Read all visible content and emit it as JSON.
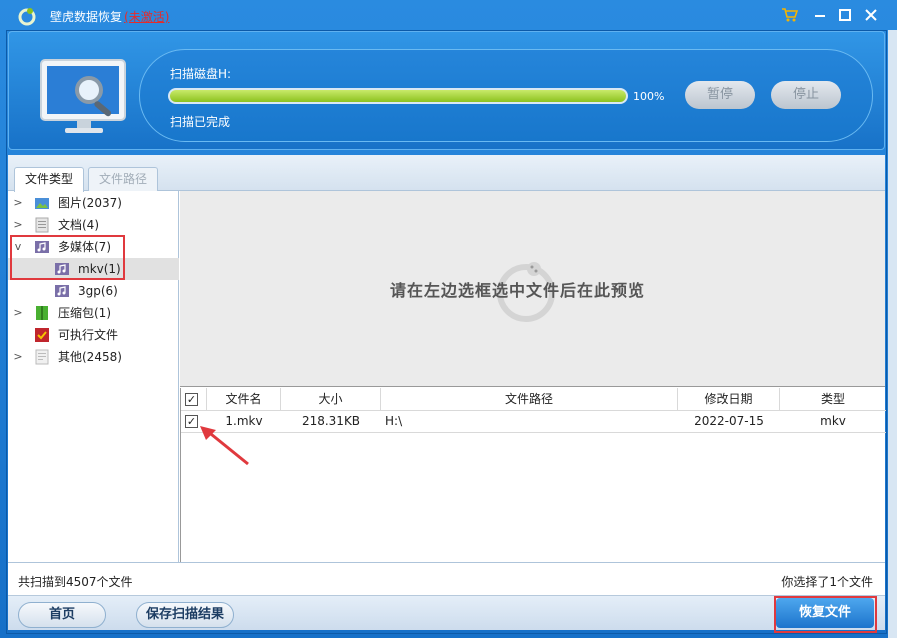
{
  "window": {
    "title": "壁虎数据恢复",
    "status": "(未激活)"
  },
  "scan": {
    "label": "扫描磁盘H:",
    "progress_percent": 100,
    "progress_text": "100%",
    "status": "扫描已完成",
    "pause_label": "暂停",
    "stop_label": "停止"
  },
  "tabs": [
    {
      "label": "文件类型"
    },
    {
      "label": "文件路径"
    }
  ],
  "tree": [
    {
      "label": "图片(2037)"
    },
    {
      "label": "文档(4)"
    },
    {
      "label": "多媒体(7)"
    },
    {
      "label": "mkv(1)"
    },
    {
      "label": "3gp(6)"
    },
    {
      "label": "压缩包(1)"
    },
    {
      "label": "可执行文件"
    },
    {
      "label": "其他(2458)"
    }
  ],
  "preview": {
    "hint": "请在左边选框选中文件后在此预览"
  },
  "table": {
    "headers": [
      "文件名",
      "大小",
      "文件路径",
      "修改日期",
      "类型"
    ],
    "rows": [
      {
        "name": "1.mkv",
        "size": "218.31KB",
        "path": "H:\\",
        "date": "2022-07-15",
        "type": "mkv"
      }
    ]
  },
  "status": {
    "total": "共扫描到4507个文件",
    "selected": "你选择了1个文件"
  },
  "buttons": {
    "home": "首页",
    "save": "保存扫描结果",
    "recover": "恢复文件"
  },
  "colors": {
    "accent_blue": "#1c74cc",
    "progress_green": "#8cc21f",
    "annotation_red": "#e0393e"
  }
}
